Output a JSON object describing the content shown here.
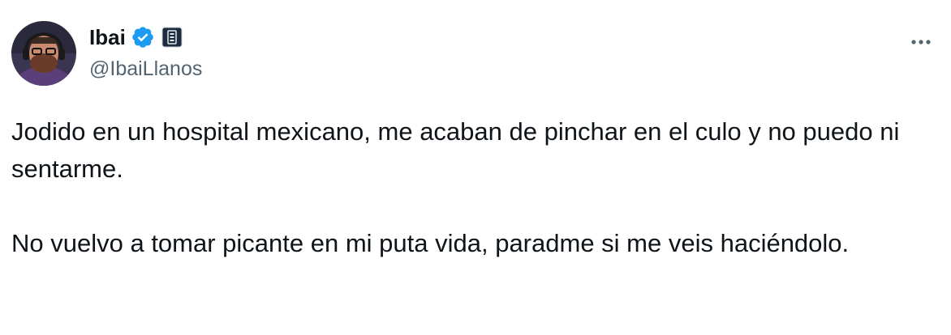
{
  "author": {
    "display_name": "Ibai",
    "handle": "@IbaiLlanos",
    "verified_color": "#1d9bf0"
  },
  "icons": {
    "verified": "verified-badge-icon",
    "affiliate": "affiliate-badge-icon",
    "more": "more-options-icon"
  },
  "tweet": {
    "paragraphs": [
      "Jodido en un hospital mexicano, me acaban de pinchar en el culo y no puedo ni sentarme.",
      "No vuelvo a tomar picante en mi puta vida, paradme si me veis haciéndolo."
    ]
  }
}
